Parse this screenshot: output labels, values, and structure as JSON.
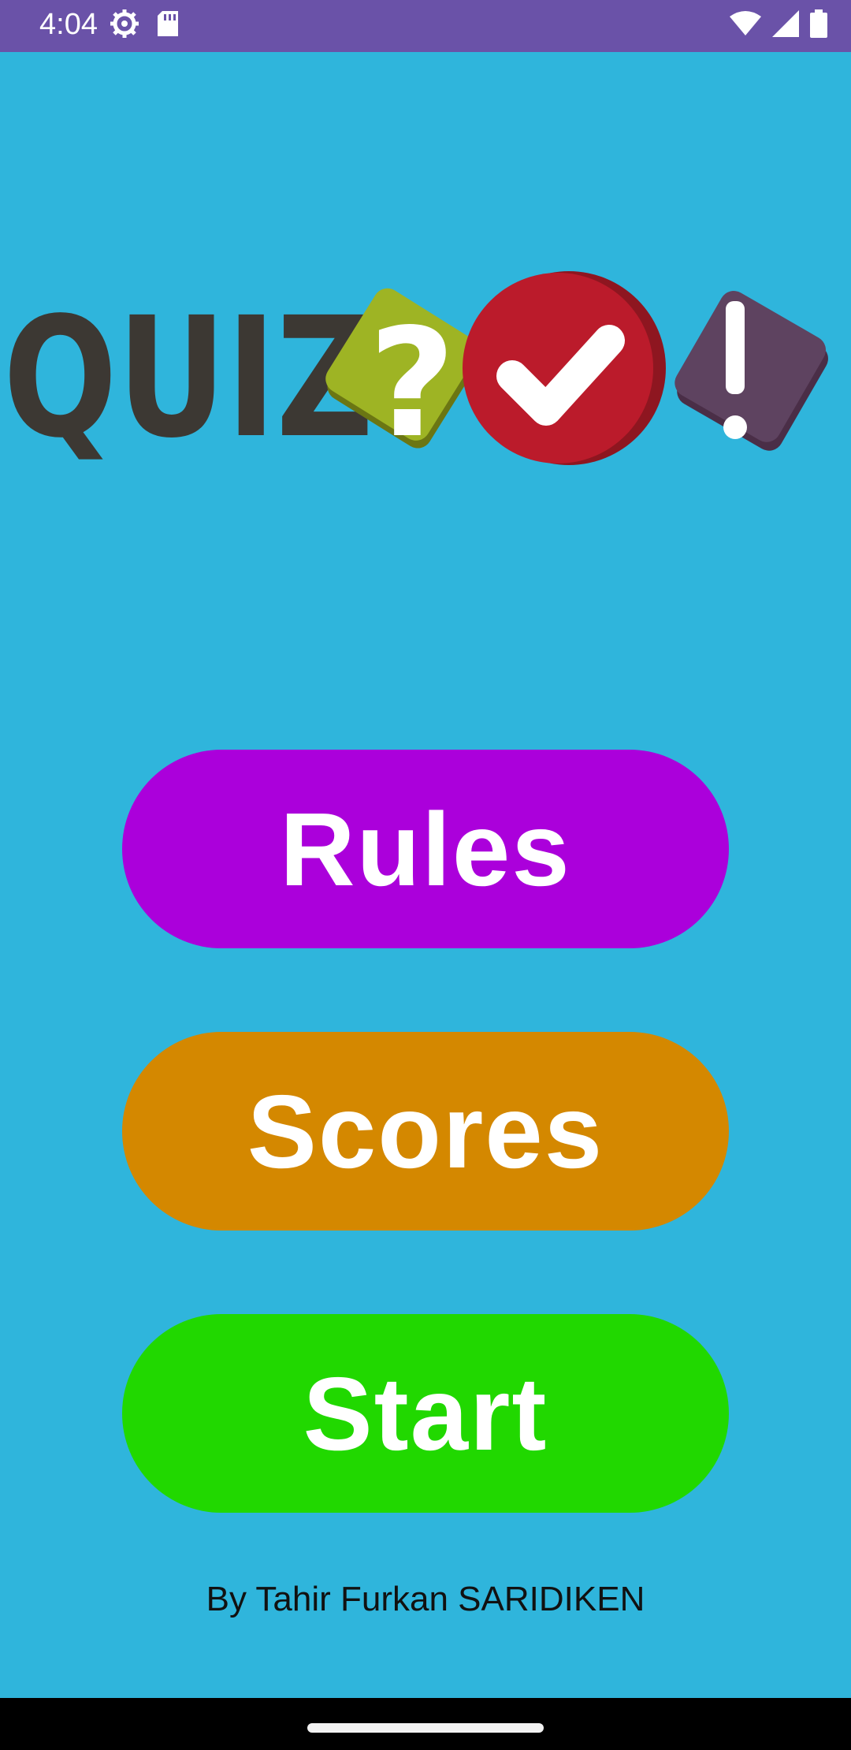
{
  "status_bar": {
    "time": "4:04",
    "left_icons": [
      "settings-icon",
      "sd-card-icon"
    ],
    "right_icons": [
      "wifi-icon",
      "cell-signal-icon",
      "battery-icon"
    ]
  },
  "logo": {
    "text": "QUIZ",
    "symbols": [
      "?",
      "✔",
      "!"
    ]
  },
  "menu": {
    "rules_label": "Rules",
    "scores_label": "Scores",
    "start_label": "Start"
  },
  "footer": {
    "credit": "By Tahir Furkan SARIDIKEN"
  },
  "colors": {
    "background": "#2fb5dc",
    "status_bar": "#6a52a8",
    "rules": "#ab00db",
    "scores": "#d48800",
    "start": "#21d800"
  }
}
